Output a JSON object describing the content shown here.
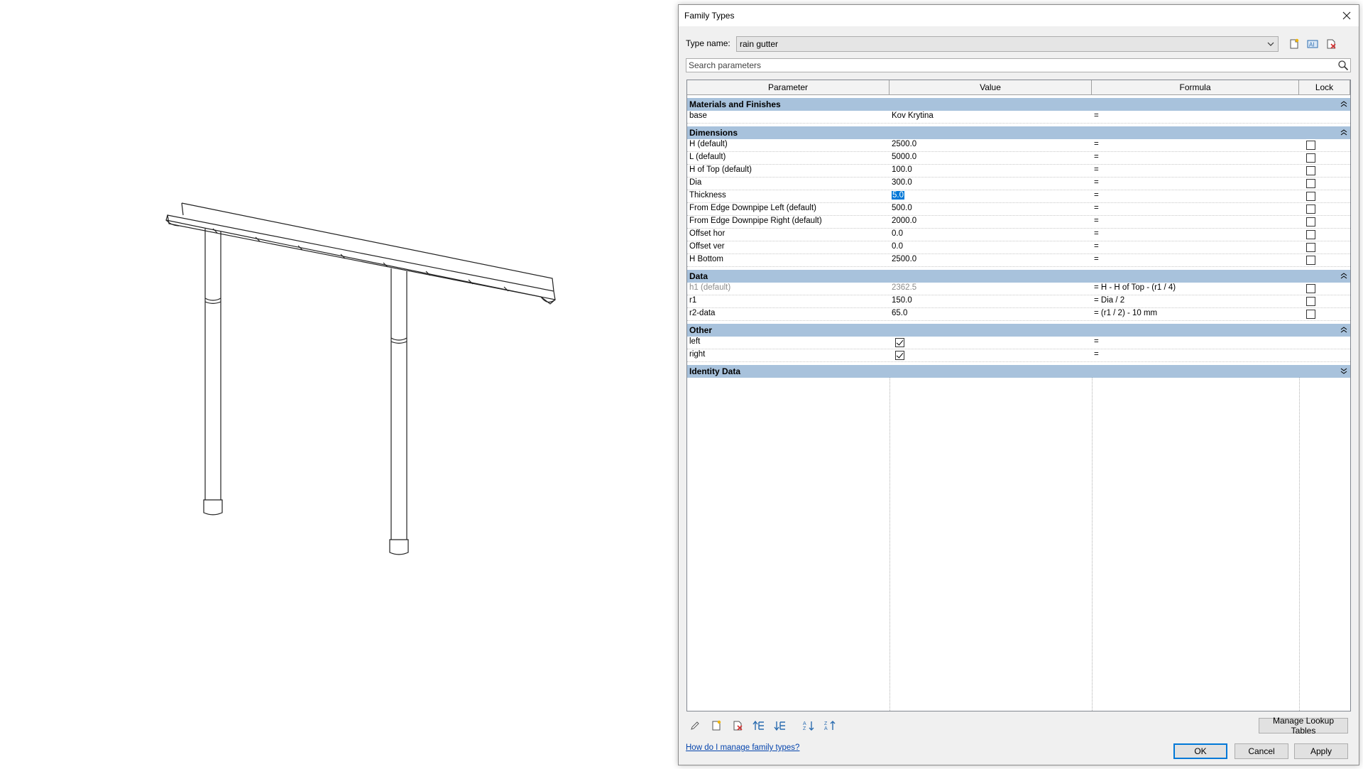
{
  "dialog": {
    "title": "Family Types",
    "type_name_label": "Type name:",
    "type_name_value": "rain gutter",
    "search_placeholder": "Search parameters",
    "columns": [
      "Parameter",
      "Value",
      "Formula",
      "Lock"
    ],
    "groups": [
      {
        "name": "Materials and Finishes",
        "rows": [
          {
            "param": "base",
            "value": "Kov Krytina",
            "formula": "=",
            "lock": null
          }
        ]
      },
      {
        "name": "Dimensions",
        "rows": [
          {
            "param": "H (default)",
            "value": "2500.0",
            "formula": "=",
            "lock": false
          },
          {
            "param": "L (default)",
            "value": "5000.0",
            "formula": "=",
            "lock": false
          },
          {
            "param": "H of Top (default)",
            "value": "100.0",
            "formula": "=",
            "lock": false
          },
          {
            "param": "Dia",
            "value": "300.0",
            "formula": "=",
            "lock": false
          },
          {
            "param": "Thickness",
            "value": "5.0",
            "formula": "=",
            "lock": false,
            "selected": true
          },
          {
            "param": "From Edge Downpipe Left (default)",
            "value": "500.0",
            "formula": "=",
            "lock": false
          },
          {
            "param": "From Edge Downpipe Right (default)",
            "value": "2000.0",
            "formula": "=",
            "lock": false
          },
          {
            "param": "Offset hor",
            "value": "0.0",
            "formula": "=",
            "lock": false
          },
          {
            "param": "Offset ver",
            "value": "0.0",
            "formula": "=",
            "lock": false
          },
          {
            "param": "H Bottom",
            "value": "2500.0",
            "formula": "=",
            "lock": false
          }
        ]
      },
      {
        "name": "Data",
        "rows": [
          {
            "param": "h1 (default)",
            "value": "2362.5",
            "formula": "= H - H of Top - (r1 / 4)",
            "lock": false,
            "muted": true
          },
          {
            "param": "r1",
            "value": "150.0",
            "formula": "= Dia / 2",
            "lock": false
          },
          {
            "param": "r2-data",
            "value": "65.0",
            "formula": "= (r1 / 2) - 10 mm",
            "lock": false
          }
        ]
      },
      {
        "name": "Other",
        "rows": [
          {
            "param": "left",
            "value_check": true,
            "formula": "=",
            "lock": null
          },
          {
            "param": "right",
            "value_check": true,
            "formula": "=",
            "lock": null
          }
        ]
      },
      {
        "name": "Identity Data",
        "collapsed": true,
        "rows": []
      }
    ],
    "buttons": {
      "manage_lookup": "Manage Lookup Tables",
      "ok": "OK",
      "cancel": "Cancel",
      "apply": "Apply"
    },
    "help_link": "How do I manage family types?"
  }
}
